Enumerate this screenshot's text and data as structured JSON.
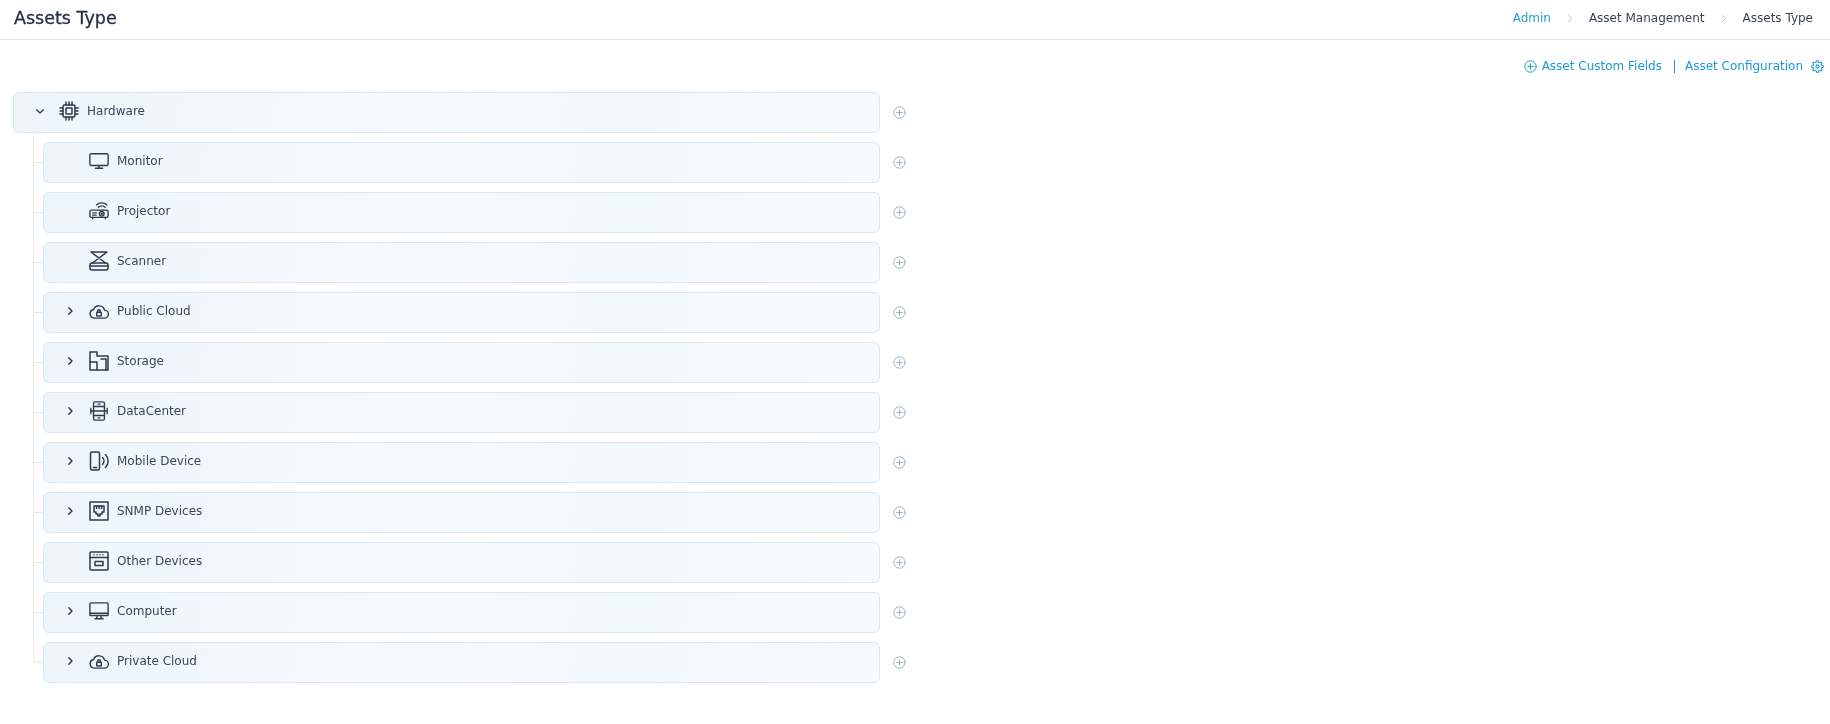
{
  "header": {
    "title": "Assets Type",
    "breadcrumb": [
      {
        "label": "Admin",
        "kind": "link"
      },
      {
        "label": "Asset Management",
        "kind": "text"
      },
      {
        "label": "Assets Type",
        "kind": "text"
      }
    ]
  },
  "actions": [
    {
      "label": "Asset Custom Fields"
    },
    {
      "label": "Asset Configuration"
    }
  ],
  "tree": {
    "label": "Hardware",
    "expanded": true,
    "children": [
      {
        "label": "Monitor"
      },
      {
        "label": "Projector"
      },
      {
        "label": "Scanner"
      },
      {
        "label": "Public Cloud",
        "expanded": false
      },
      {
        "label": "Storage",
        "expanded": false
      },
      {
        "label": "DataCenter",
        "expanded": false
      },
      {
        "label": "Mobile Device",
        "expanded": false
      },
      {
        "label": "SNMP Devices",
        "expanded": false
      },
      {
        "label": "Other Devices"
      },
      {
        "label": "Computer",
        "expanded": false
      },
      {
        "label": "Private Cloud",
        "expanded": false
      }
    ]
  }
}
